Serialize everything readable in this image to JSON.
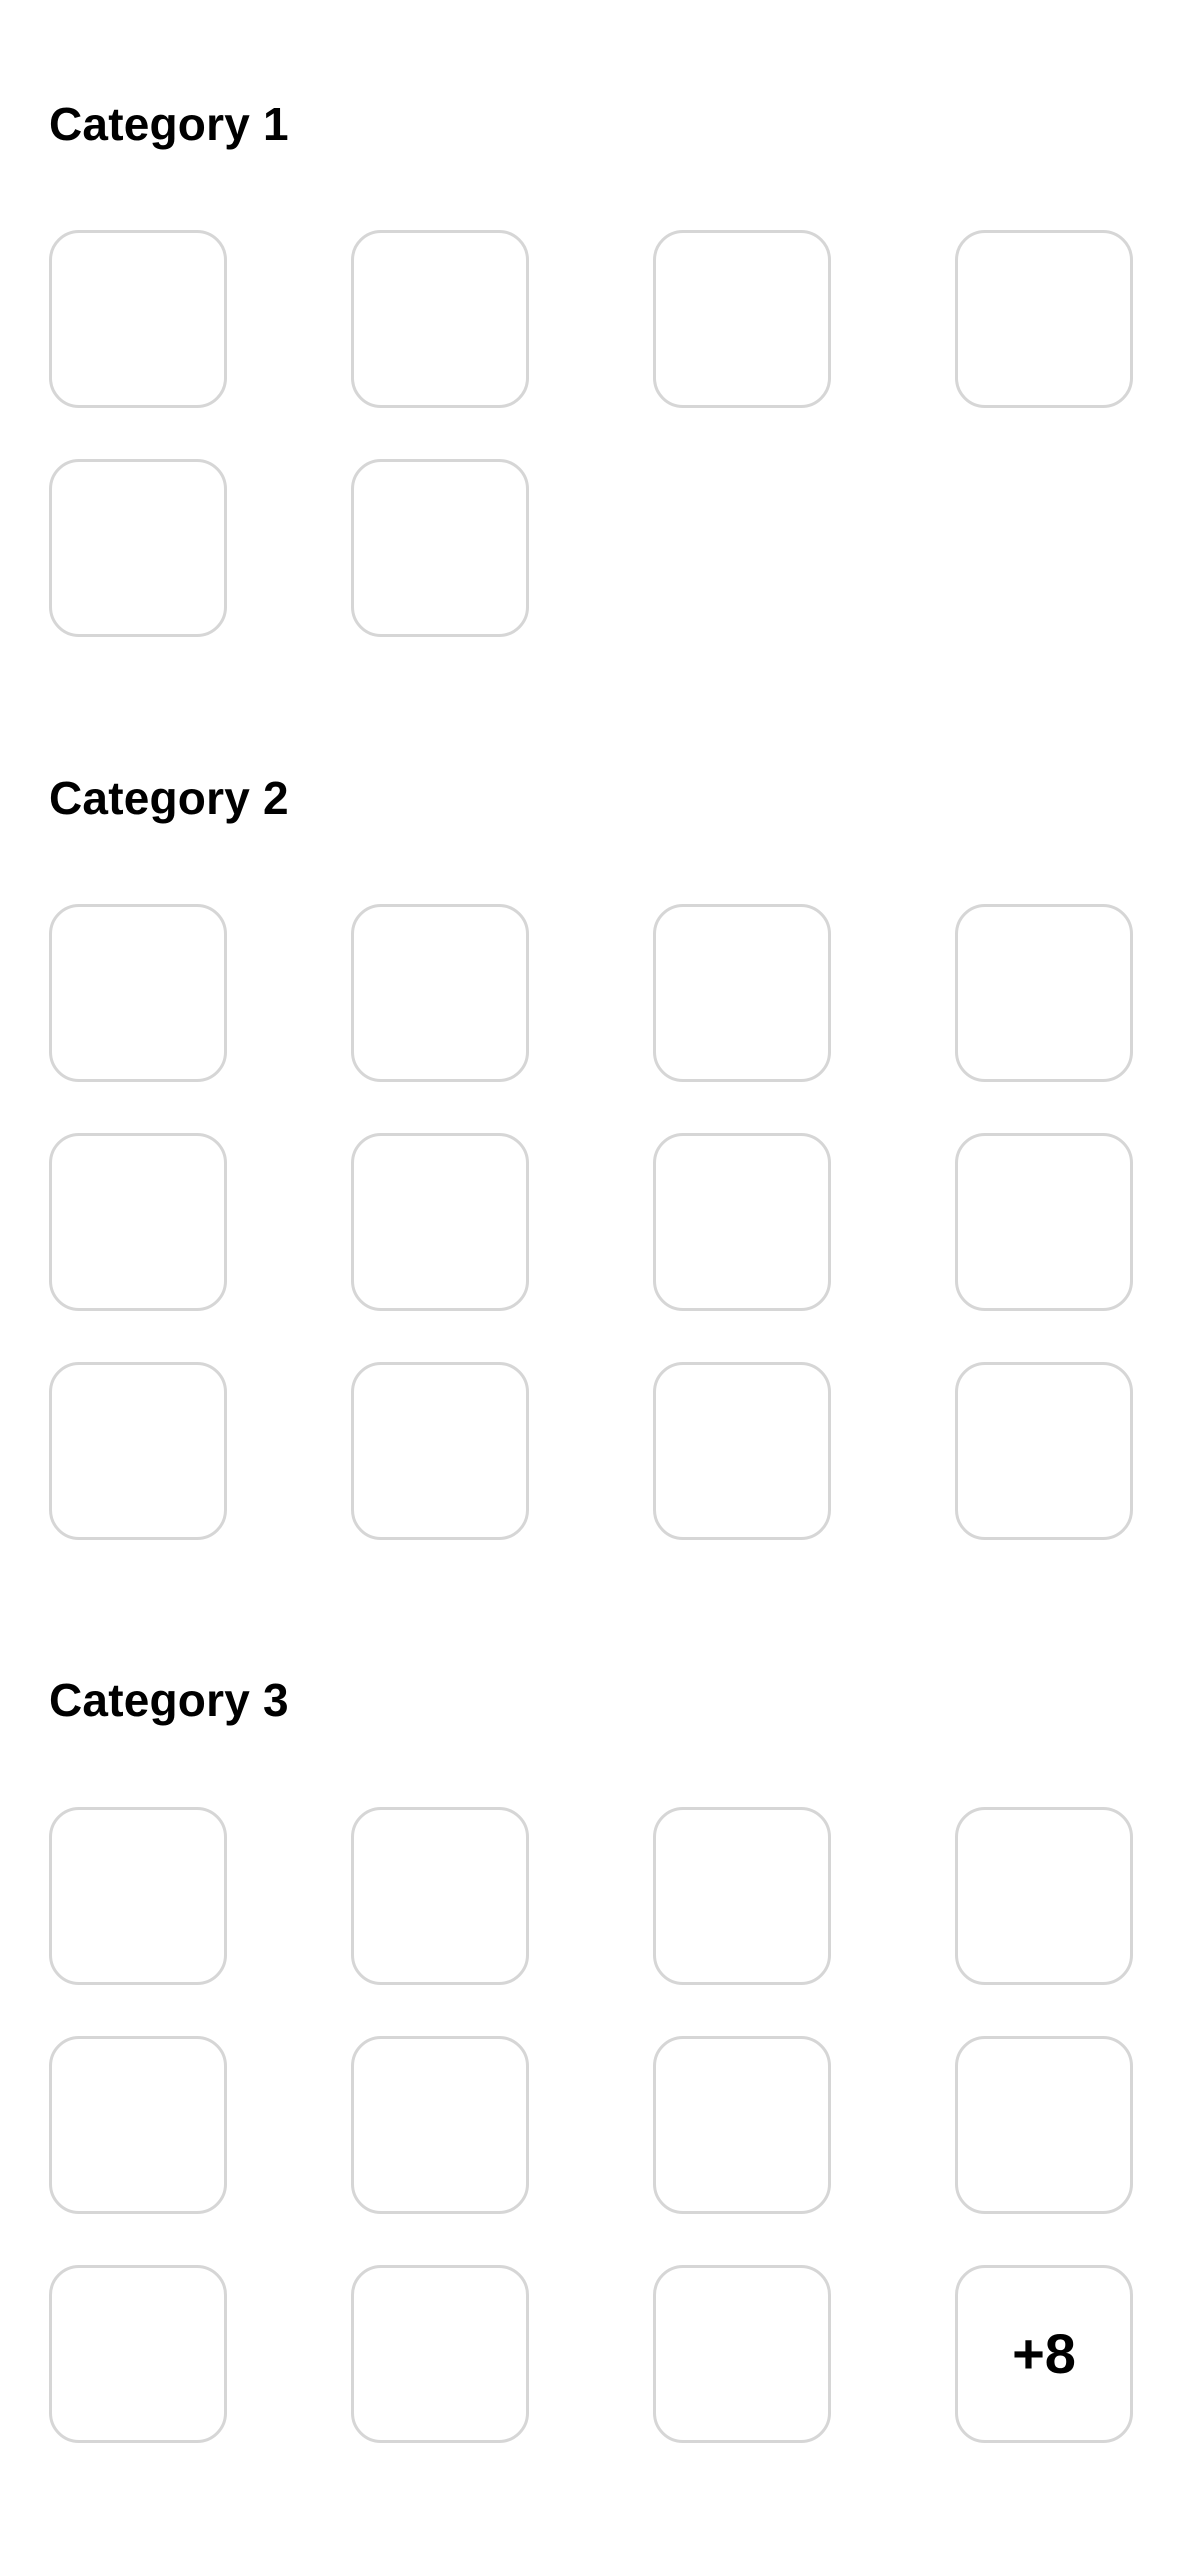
{
  "sections": [
    {
      "title": "Category 1",
      "tile_count": 6
    },
    {
      "title": "Category 2",
      "tile_count": 12
    },
    {
      "title": "Category 3",
      "tile_count": 12,
      "overflow_label": "+8"
    }
  ],
  "colors": {
    "background": "#ffffff",
    "tile_border": "#d6d6d6",
    "text": "#000000"
  }
}
